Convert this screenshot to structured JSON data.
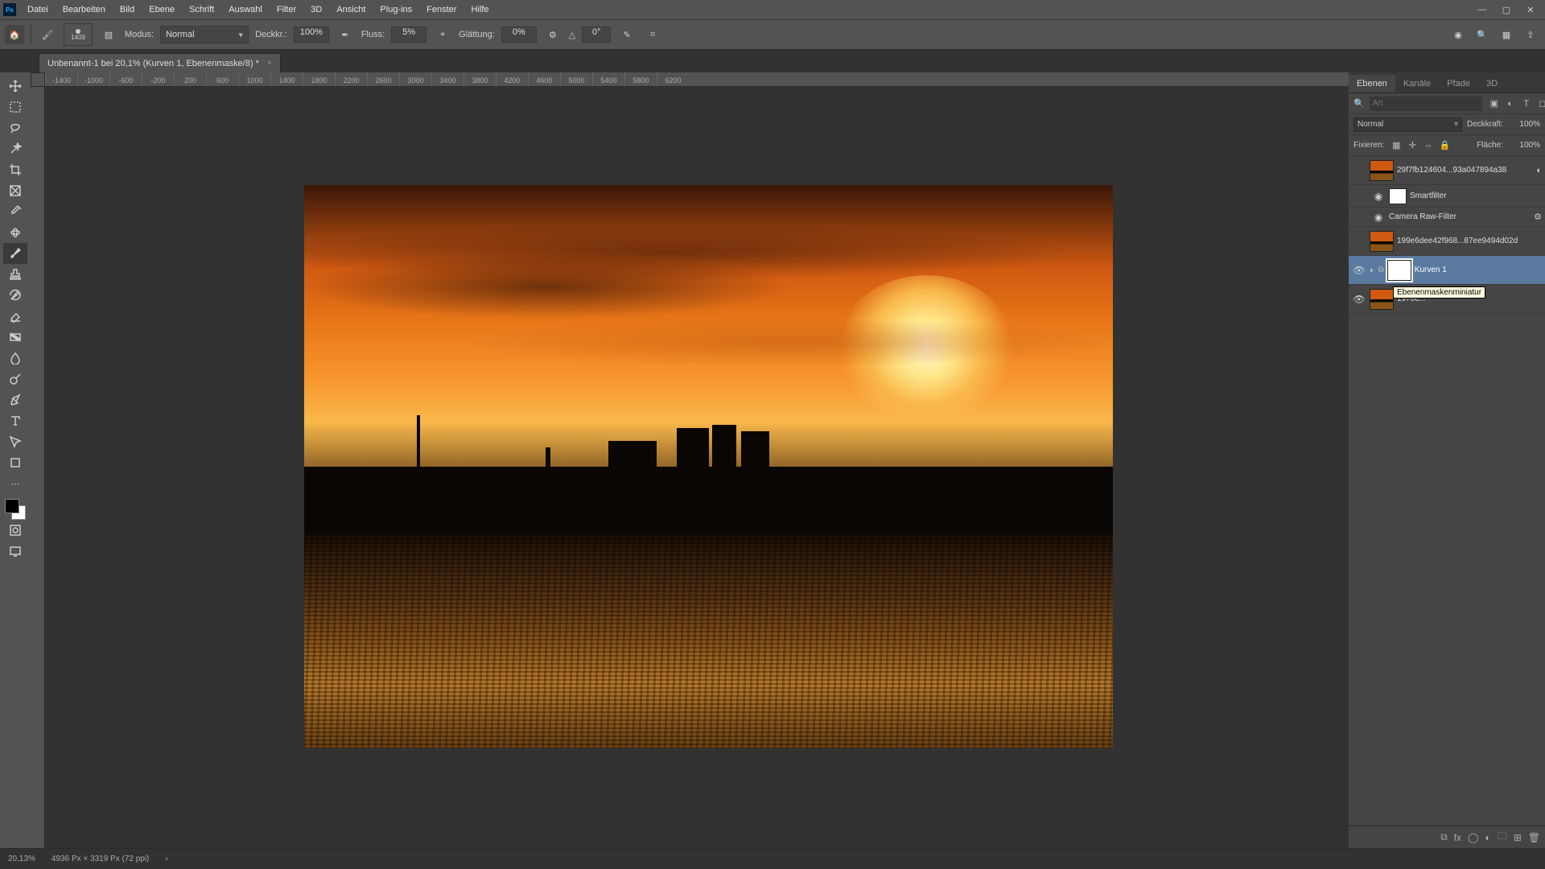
{
  "menu": {
    "items": [
      "Datei",
      "Bearbeiten",
      "Bild",
      "Ebene",
      "Schrift",
      "Auswahl",
      "Filter",
      "3D",
      "Ansicht",
      "Plug-ins",
      "Fenster",
      "Hilfe"
    ]
  },
  "win": {
    "min": "—",
    "max": "▢",
    "close": "✕"
  },
  "options": {
    "brush_size": "1409",
    "mode_label": "Modus:",
    "mode_value": "Normal",
    "opacity_label": "Deckkr.:",
    "opacity_value": "100%",
    "flow_label": "Fluss:",
    "flow_value": "5%",
    "smooth_label": "Glättung:",
    "smooth_value": "0%",
    "angle_label": "△",
    "angle_value": "0°"
  },
  "doc_tab": "Unbenannt-1 bei 20,1% (Kurven 1, Ebenenmaske/8) *",
  "ruler": {
    "ticks": [
      "-1400",
      "-1000",
      "-600",
      "-200",
      "200",
      "600",
      "1000",
      "1400",
      "1800",
      "2200",
      "2600",
      "3000",
      "3400",
      "3800",
      "4200",
      "4600",
      "5000",
      "5400",
      "5800",
      "6200"
    ]
  },
  "panels": {
    "tabs": [
      "Ebenen",
      "Kanäle",
      "Pfade",
      "3D"
    ],
    "search_placeholder": "Art",
    "blend": "Normal",
    "blend_opacity_label": "Deckkraft:",
    "blend_opacity": "100%",
    "lock_label": "Fixieren:",
    "fill_label": "Fläche:",
    "fill_value": "100%"
  },
  "layers": [
    {
      "vis": "",
      "name": "29f7fb124604...93a047894a38",
      "type": "smart"
    },
    {
      "vis": "",
      "name": "Smartfilter",
      "type": "sub-mask"
    },
    {
      "vis": "",
      "name": "Camera Raw-Filter",
      "type": "sub-filter"
    },
    {
      "vis": "",
      "name": "199e6dee42f968...87ee9494d02d",
      "type": "smart"
    },
    {
      "vis": "👁",
      "name": "Kurven 1",
      "type": "adj",
      "selected": true
    },
    {
      "vis": "👁",
      "name": "1970c...",
      "tooltip": "Ebenenmaskenminiatur",
      "type": "img"
    }
  ],
  "status": {
    "zoom": "20,13%",
    "doc": "4936 Px × 3319 Px (72 ppi)"
  }
}
